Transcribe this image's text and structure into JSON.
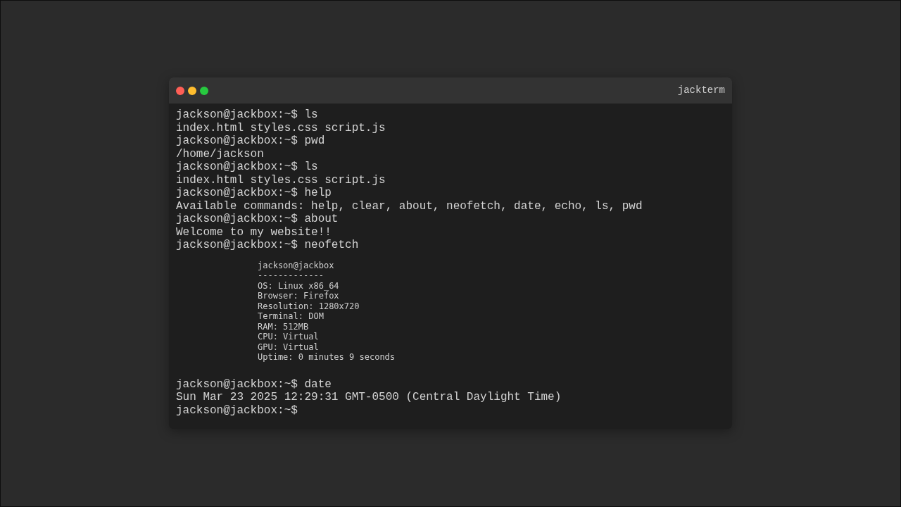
{
  "window": {
    "title": "jackterm",
    "controls": [
      {
        "color": "#ff5f56"
      },
      {
        "color": "#ffbd2e"
      },
      {
        "color": "#27c93f"
      }
    ]
  },
  "lines": [
    {
      "kind": "prompt",
      "prompt": "jackson@jackbox:~$",
      "command": "ls"
    },
    {
      "kind": "output",
      "text": "index.html styles.css script.js"
    },
    {
      "kind": "prompt",
      "prompt": "jackson@jackbox:~$",
      "command": "pwd"
    },
    {
      "kind": "output",
      "text": "/home/jackson"
    },
    {
      "kind": "prompt",
      "prompt": "jackson@jackbox:~$",
      "command": "ls"
    },
    {
      "kind": "output",
      "text": "index.html styles.css script.js"
    },
    {
      "kind": "prompt",
      "prompt": "jackson@jackbox:~$",
      "command": "help"
    },
    {
      "kind": "output",
      "text": "Available commands: help, clear, about, neofetch, date, echo, ls, pwd"
    },
    {
      "kind": "prompt",
      "prompt": "jackson@jackbox:~$",
      "command": "about"
    },
    {
      "kind": "output",
      "text": "Welcome to my website!!"
    },
    {
      "kind": "prompt",
      "prompt": "jackson@jackbox:~$",
      "command": "neofetch"
    },
    {
      "kind": "neofetch",
      "lines": [
        "jackson@jackbox",
        "-------------",
        "OS: Linux x86_64",
        "Browser: Firefox",
        "Resolution: 1280x720",
        "Terminal: DOM",
        "RAM: 512MB",
        "CPU: Virtual",
        "GPU: Virtual",
        "Uptime: 0 minutes 9 seconds"
      ]
    },
    {
      "kind": "prompt",
      "prompt": "jackson@jackbox:~$",
      "command": "date"
    },
    {
      "kind": "output",
      "text": "Sun Mar 23 2025 12:29:31 GMT-0500 (Central Daylight Time)"
    },
    {
      "kind": "prompt",
      "prompt": "jackson@jackbox:~$"
    }
  ]
}
